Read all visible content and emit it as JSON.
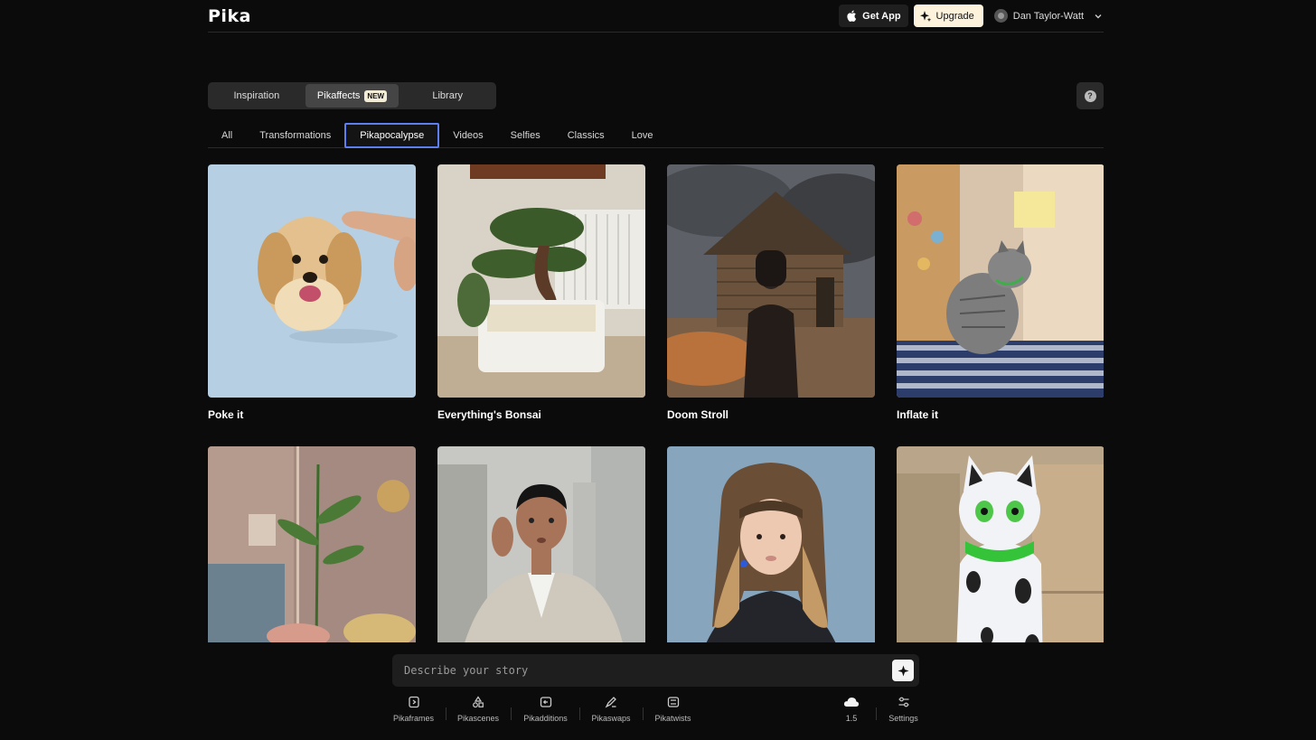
{
  "app": {
    "logo": "Pika"
  },
  "header": {
    "get_app_label": "Get App",
    "upgrade_label": "Upgrade",
    "user_name": "Dan Taylor-Watt"
  },
  "main_tabs": [
    {
      "label": "Inspiration"
    },
    {
      "label": "Pikaffects",
      "badge": "NEW"
    },
    {
      "label": "Library"
    }
  ],
  "help": {
    "label": "?"
  },
  "sub_tabs": [
    {
      "label": "All"
    },
    {
      "label": "Transformations"
    },
    {
      "label": "Pikapocalypse"
    },
    {
      "label": "Videos"
    },
    {
      "label": "Selfies"
    },
    {
      "label": "Classics"
    },
    {
      "label": "Love"
    }
  ],
  "cards": [
    {
      "title": "Poke it"
    },
    {
      "title": "Everything's Bonsai"
    },
    {
      "title": "Doom Stroll"
    },
    {
      "title": "Inflate it"
    },
    {
      "title": ""
    },
    {
      "title": ""
    },
    {
      "title": ""
    },
    {
      "title": ""
    }
  ],
  "prompt": {
    "placeholder": "Describe your story"
  },
  "toolbar": {
    "pikaframes": "Pikaframes",
    "pikascenes": "Pikascenes",
    "pikadditions": "Pikadditions",
    "pikaswaps": "Pikaswaps",
    "pikatwists": "Pikatwists",
    "model_version": "1.5",
    "settings": "Settings"
  },
  "colors": {
    "background": "#0b0b0b",
    "active_subtab_border": "#5d7ff0",
    "upgrade_bg": "#fdf3dc"
  }
}
